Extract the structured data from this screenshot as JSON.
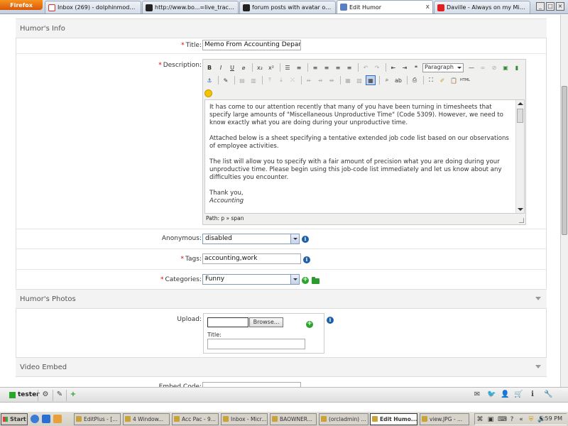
{
  "browser": {
    "app_button": "Firefox",
    "tabs": [
      {
        "label": "Inbox (269) - dolphinmods@...",
        "color": "#d93025"
      },
      {
        "label": "http://www.bo...=live_tracker",
        "color": "#222222"
      },
      {
        "label": "forum posts with avatar on in...",
        "color": "#222222"
      },
      {
        "label": "Edit Humor",
        "color": "#5a7fc6"
      },
      {
        "label": "Daville - Always on my Mind -...",
        "color": "#e02020"
      }
    ],
    "new_tab": "+",
    "tab_close": "x"
  },
  "form": {
    "section_info": "Humor's Info",
    "title_label": "Title:",
    "title_value": "Memo From Accounting Department",
    "description_label": "Description:",
    "editor": {
      "format_select": "Paragraph",
      "paragraphs": [
        "It has come to our attention recently that many of you have been turning in timesheets that specify large amounts of \"Miscellaneous Unproductive Time\" (Code 5309). However, we need to know exactly what you are doing during your unproductive time.",
        "Attached below is a sheet specifying a tentative extended job code list based on our observations of employee activities.",
        "The list will allow you to specify with a fair amount of precision what you are doing during your unproductive time. Please begin using this job-code list immediately and let us know about any difficulties you encounter."
      ],
      "signoff": "Thank you,",
      "signature": "Accounting",
      "path": "Path: p » span"
    },
    "anonymous_label": "Anonymous:",
    "anonymous_value": "disabled",
    "tags_label": "Tags:",
    "tags_value": "accounting,work",
    "categories_label": "Categories:",
    "categories_value": "Funny",
    "section_photos": "Humor's Photos",
    "upload_label": "Upload:",
    "browse_button": "Browse...",
    "photo_title_label": "Title:",
    "section_video": "Video Embed",
    "embed_label": "Embed Code:"
  },
  "sitebar": {
    "username": "tester"
  },
  "taskbar": {
    "start": "Start",
    "tasks": [
      "EditPlus - [...",
      "4 Window...",
      "Acc Pac - 9...",
      "Inbox - Micr...",
      "BAOWNER...",
      "(orcladmin) ...",
      "Edit Humo...",
      "view.JPG - ..."
    ],
    "clock": "5:59 PM"
  }
}
